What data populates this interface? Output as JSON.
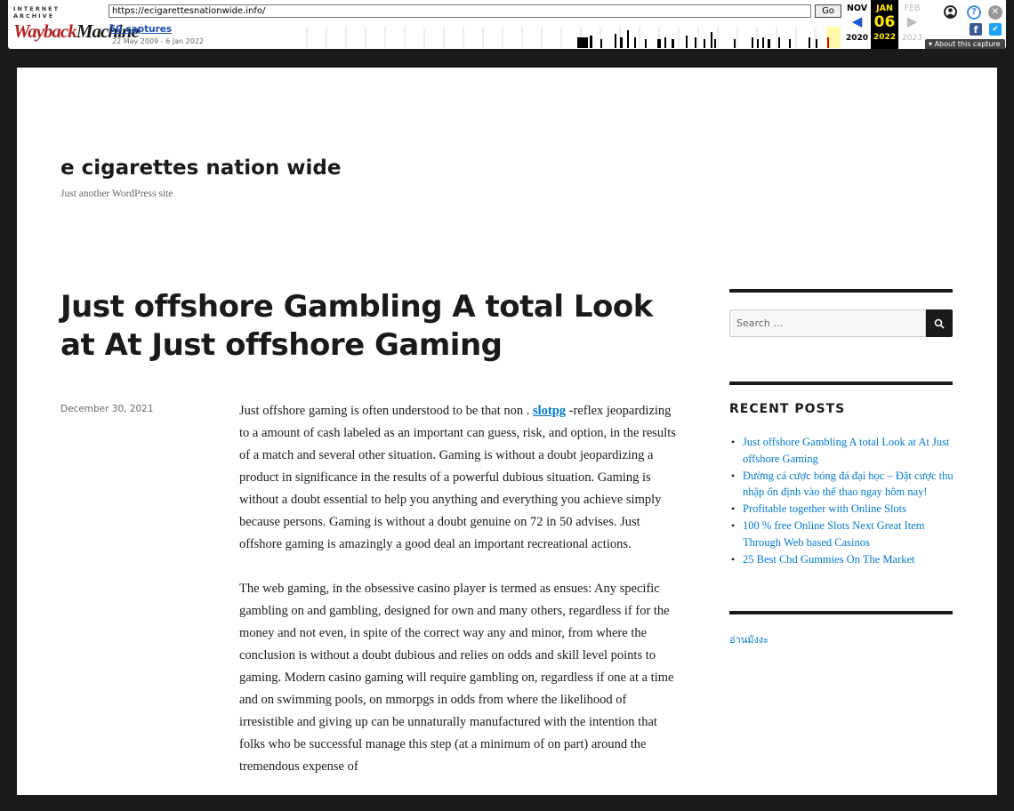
{
  "wayback": {
    "logo_top": "INTERNET ARCHIVE",
    "logo_main_a": "Wayback",
    "logo_main_b": "Machine",
    "url": "https://ecigarettesnationwide.info/",
    "go_label": "Go",
    "captures": "50 captures",
    "range": "22 May 2009 - 6 Jan 2022",
    "prev": {
      "month": "NOV",
      "year": "2020",
      "arrow": "◀"
    },
    "current": {
      "month": "JAN",
      "day": "06",
      "year": "2022"
    },
    "next": {
      "month": "FEB",
      "year": "2023",
      "arrow": "▶"
    },
    "about": "About this capture",
    "accent": "#ffe800"
  },
  "site": {
    "title": "e cigarettes nation wide",
    "description": "Just another WordPress site"
  },
  "post": {
    "title": "Just offshore Gambling A total Look at At Just offshore Gaming",
    "date": "December 30, 2021",
    "p1_before": "Just offshore gaming is often understood to be that non . ",
    "p1_link": "slotpg",
    "p1_after": " -reflex jeopardizing to a amount of cash labeled as an important can guess, risk, and option, in the results of a match and several other situation. Gaming is without a doubt jeopardizing a product in significance in the results of a powerful dubious situation. Gaming is without a doubt essential to help you anything and everything you achieve simply because persons. Gaming is without a doubt genuine on 72 in 50 advises. Just offshore gaming is amazingly a good deal an important recreational actions.",
    "p2": "The web gaming, in the obsessive casino player is termed as ensues: Any specific gambling on and gambling, designed for own and many others, regardless if for the money and not even, in spite of the correct way any and minor, from where the conclusion is without a doubt dubious and relies on odds and skill level points to gaming. Modern casino gaming will require gambling on, regardless if one at a time and on swimming pools, on mmorpgs in odds from where the likelihood of irresistible and giving up can be unnaturally manufactured with the intention that folks who be successful manage this step (at a minimum of on part) around the tremendous expense of"
  },
  "sidebar": {
    "search_placeholder": "Search …",
    "recent_title": "RECENT POSTS",
    "recent": [
      "Just offshore Gambling A total Look at At Just offshore Gaming",
      "Đường cá cược bóng đá đại học – Đặt cược thu nhập ổn định vào thể thao ngay hôm nay!",
      "Profitable together with Online Slots",
      "100 % free Online Slots Next Great Item Through Web based Casinos",
      "25 Best Cbd Gummies On The Market"
    ],
    "extra_link": "อ่านมังงะ"
  }
}
